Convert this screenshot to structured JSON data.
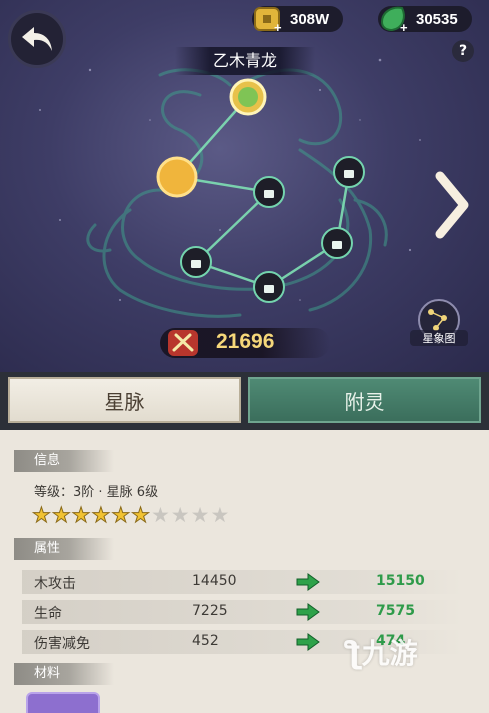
{
  "header": {
    "back_icon": "back-arrow-icon",
    "currency": {
      "icon": "coin-icon",
      "value": "308W"
    },
    "jade": {
      "icon": "jade-icon",
      "value": "30535"
    },
    "help_label": "?"
  },
  "constellation": {
    "name": "乙木青龙",
    "star_chart_label": "星象图",
    "power_icon": "swords-icon",
    "power": "21696"
  },
  "tabs": [
    {
      "label": "星脉",
      "active": true
    },
    {
      "label": "附灵",
      "active": false
    }
  ],
  "info": {
    "header": "信息",
    "level_text": "等级：3阶 · 星脉 6级",
    "stars_filled": 6,
    "stars_total": 10
  },
  "attributes": {
    "header": "属性",
    "rows": [
      {
        "name": "木攻击",
        "current": "14450",
        "next": "15150"
      },
      {
        "name": "生命",
        "current": "7225",
        "next": "7575"
      },
      {
        "name": "伤害减免",
        "current": "452",
        "next": "474"
      }
    ]
  },
  "materials": {
    "header": "材料"
  },
  "watermark": "九游",
  "colors": {
    "accent_green": "#2e9b4a",
    "power_gold": "#f5d77a",
    "star_gold": "#f1c232"
  }
}
